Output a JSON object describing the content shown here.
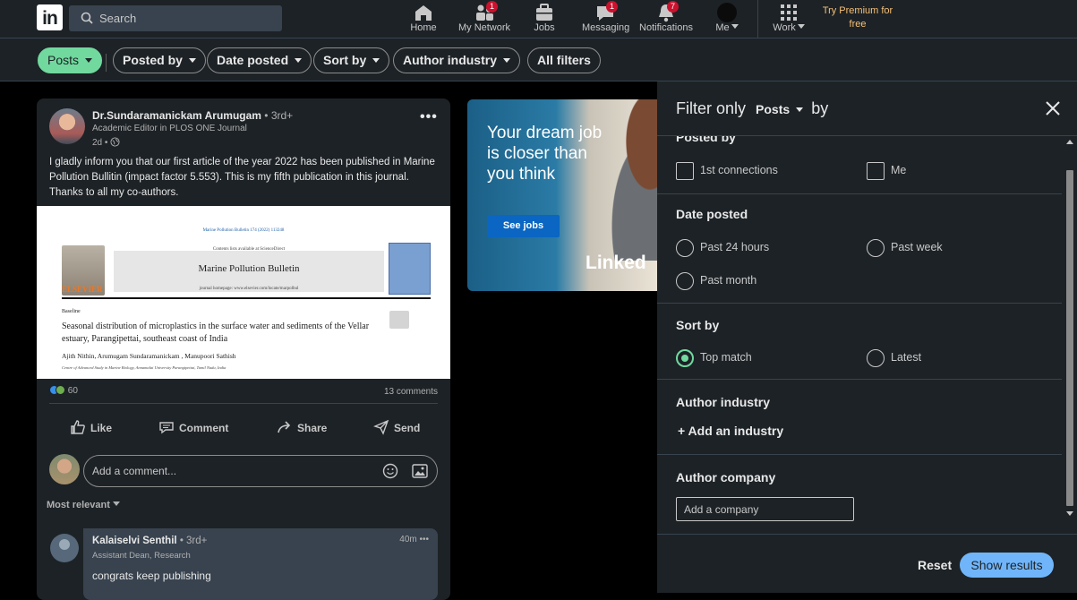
{
  "topnav": {
    "logo": "in",
    "search_placeholder": "Search",
    "items": [
      {
        "label": "Home",
        "badge": ""
      },
      {
        "label": "My Network",
        "badge": "1"
      },
      {
        "label": "Jobs",
        "badge": ""
      },
      {
        "label": "Messaging",
        "badge": "1"
      },
      {
        "label": "Notifications",
        "badge": "7"
      },
      {
        "label": "Me",
        "badge": ""
      },
      {
        "label": "Work",
        "badge": ""
      }
    ],
    "premium": "Try Premium for free"
  },
  "filters": {
    "posts": "Posts",
    "posted_by": "Posted by",
    "date_posted": "Date posted",
    "sort_by": "Sort by",
    "author_industry": "Author industry",
    "all_filters": "All filters"
  },
  "post": {
    "author": "Dr.Sundaramanickam Arumugam",
    "degree": "• 3rd+",
    "headline": "Academic Editor in PLOS ONE Journal",
    "time": "2d •",
    "text": "I gladly inform you that our first article of the year 2022 has been published in Marine Pollution Bullitin (impact factor 5.553). This is my fifth publication in this journal. Thanks to all my co-authors.",
    "document": {
      "journal_line": "Marine Pollution Bulletin 174 (2022) 113248",
      "contents": "Contents lists available at ScienceDirect",
      "journal": "Marine Pollution Bulletin",
      "homepage": "journal homepage: www.elsevier.com/locate/marpolbul",
      "publisher": "ELSEVIER",
      "section": "Baseline",
      "title": "Seasonal distribution of microplastics in the surface water and sediments of the Vellar estuary, Parangipettai, southeast coast of India",
      "authors": "Ajith Nithin, Arumugam Sundaramanickam , Manupoori Sathish",
      "affiliation": "Centre of Advanced Study in Marine Biology, Annamalai University Parangipettai, Tamil Nadu, India"
    },
    "reactions": "60",
    "comments": "13 comments",
    "actions": {
      "like": "Like",
      "comment": "Comment",
      "share": "Share",
      "send": "Send"
    },
    "comment_placeholder": "Add a comment...",
    "sort": "Most relevant"
  },
  "comment": {
    "name": "Kalaiselvi Senthil",
    "degree": "• 3rd+",
    "headline": "Assistant Dean, Research",
    "time": "40m •••",
    "text": "congrats keep publishing"
  },
  "ad": {
    "headline": "Your dream job is closer than you think",
    "button": "See jobs",
    "brand": "Linked"
  },
  "panel": {
    "title_prefix": "Filter only",
    "title_select": "Posts",
    "title_suffix": "by",
    "posted_by": "Posted by",
    "posted_by_opts": [
      "1st connections",
      "Me"
    ],
    "date_posted": "Date posted",
    "date_opts": [
      "Past 24 hours",
      "Past week",
      "Past month"
    ],
    "sort_by": "Sort by",
    "sort_opts": [
      "Top match",
      "Latest"
    ],
    "author_industry": "Author industry",
    "add_industry": "+ Add an industry",
    "author_company": "Author company",
    "company_placeholder": "Add a company",
    "reset": "Reset",
    "show_results": "Show results"
  },
  "colors": {
    "accent_green": "#71d99e",
    "primary_blue": "#70b5f9",
    "badge_red": "#cb112d",
    "premium_gold": "#f5c075"
  }
}
